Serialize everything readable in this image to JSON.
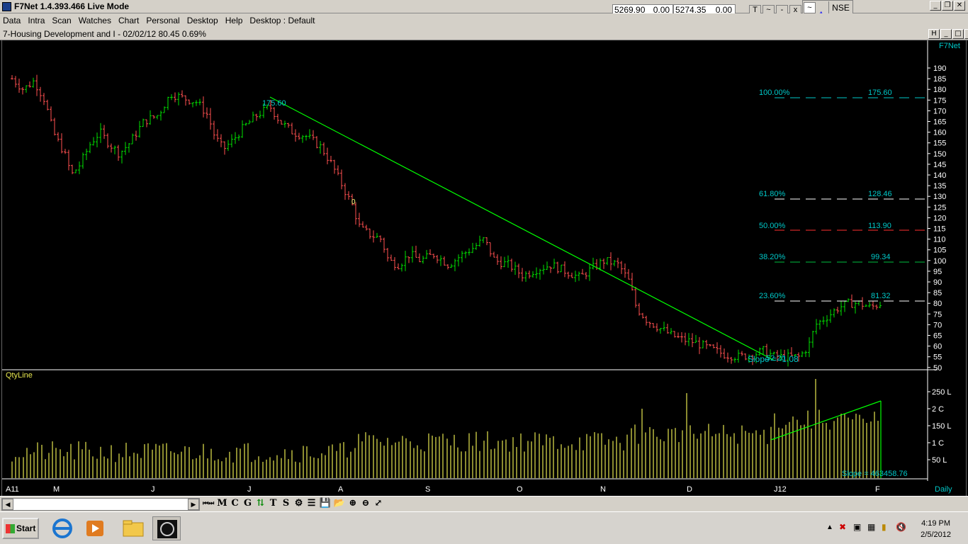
{
  "app": {
    "title": "F7Net 1.4.393.466 Live Mode"
  },
  "menu": [
    "Data",
    "Intra",
    "Scan",
    "Watches",
    "Chart",
    "Personal",
    "Desktop",
    "Help",
    "Desktop : Default"
  ],
  "quotes": {
    "q1": "5269.90",
    "q1_change": "0.00",
    "q2": "5274.35",
    "q2_change": "0.00"
  },
  "quote_buttons": [
    "T",
    "~",
    "-",
    "x"
  ],
  "side_buttons": [
    "~",
    "H",
    "x"
  ],
  "side_letters": [
    "A",
    "D",
    "S"
  ],
  "exchange": "NSE",
  "subwindow": {
    "title": "7-Housing Development and I - 02/02/12 80.45 0.69%",
    "brand": "F7Net"
  },
  "price_axis": [
    "190",
    "185",
    "180",
    "175",
    "170",
    "165",
    "160",
    "155",
    "150",
    "145",
    "140",
    "135",
    "130",
    "125",
    "120",
    "115",
    "110",
    "105",
    "100",
    "95",
    "90",
    "85",
    "80",
    "75",
    "70",
    "65",
    "60",
    "55",
    "50"
  ],
  "fib_levels": [
    {
      "pct": "100.00%",
      "value": "175.60",
      "color": "#00c8c8"
    },
    {
      "pct": "61.80%",
      "value": "128.46",
      "color": "#ffffff"
    },
    {
      "pct": "50.00%",
      "value": "113.90",
      "color": "#ff3030"
    },
    {
      "pct": "38.20%",
      "value": "99.34",
      "color": "#00c040"
    },
    {
      "pct": "23.60%",
      "value": "81.32",
      "color": "#ffffff"
    }
  ],
  "annotations": {
    "high": "175.60",
    "low": "52.20",
    "slope": "Slope = -1.08",
    "vol_slope": "Slope = 463458.76",
    "marker": "0"
  },
  "volume_panel": {
    "label": "QtyLine",
    "axis": [
      "250 L",
      "2 C",
      "150 L",
      "1 C",
      "50 L"
    ]
  },
  "time_axis": [
    "A11",
    "M",
    "J",
    "J",
    "A",
    "S",
    "O",
    "N",
    "D",
    "J12",
    "F"
  ],
  "period": "Daily",
  "toolbar": [
    "M",
    "C",
    "G",
    "T",
    "S"
  ],
  "clock": {
    "time": "4:19 PM",
    "date": "2/5/2012"
  },
  "start_label": "Start",
  "colors": {
    "up": "#00e000",
    "down": "#ff5050",
    "fib_text": "#00c8c8",
    "trend": "#00ff00",
    "volume": "#e8e850"
  }
}
